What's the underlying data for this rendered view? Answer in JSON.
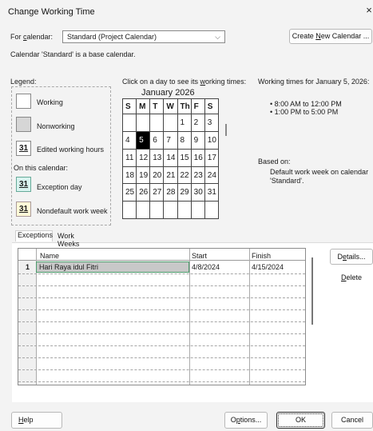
{
  "window": {
    "title": "Change Working Time",
    "close_glyph": "×"
  },
  "calendar_select": {
    "label_prefix": "For ",
    "label_mnemonic": "c",
    "label_suffix": "alendar:",
    "value": "Standard (Project Calendar)",
    "chevron": "⌵"
  },
  "create_button": {
    "prefix": "Create ",
    "mnemonic": "N",
    "suffix": "ew Calendar ..."
  },
  "base_note": "Calendar 'Standard' is a base calendar.",
  "legend": {
    "heading": "Legend:",
    "working": "Working",
    "nonworking": "Nonworking",
    "edited_num": "31",
    "edited": "Edited working hours",
    "on_this_calendar": "On this calendar:",
    "exception_num": "31",
    "exception": "Exception day",
    "nondefault_num": "31",
    "nondefault": "Nondefault work week"
  },
  "calendar_view": {
    "instruction_a": "Click on a day to see its ",
    "instruction_mn": "w",
    "instruction_b": "orking times:",
    "month": "January 2026",
    "days_header": [
      "S",
      "M",
      "T",
      "W",
      "Th",
      "F",
      "S"
    ],
    "weeks": [
      [
        "",
        "",
        "",
        "",
        "1",
        "2",
        "3"
      ],
      [
        "4",
        "5",
        "6",
        "7",
        "8",
        "9",
        "10"
      ],
      [
        "11",
        "12",
        "13",
        "14",
        "15",
        "16",
        "17"
      ],
      [
        "18",
        "19",
        "20",
        "21",
        "22",
        "23",
        "24"
      ],
      [
        "25",
        "26",
        "27",
        "28",
        "29",
        "30",
        "31"
      ],
      [
        "",
        "",
        "",
        "",
        "",
        "",
        ""
      ]
    ],
    "selected_day": "5"
  },
  "working_times": {
    "heading": "Working times for January 5, 2026:",
    "slots": [
      "• 8:00 AM to 12:00 PM",
      "• 1:00 PM to 5:00 PM"
    ],
    "based_on": "Based on:",
    "based_detail_1": "Default work week on calendar",
    "based_detail_2": "'Standard'."
  },
  "tabs": [
    {
      "label": "Exceptions",
      "active": true
    },
    {
      "label": "Work Weeks",
      "active": false
    }
  ],
  "exceptions_table": {
    "columns": [
      "Name",
      "Start",
      "Finish"
    ],
    "rows": [
      {
        "id": "1",
        "name": "Hari Raya idul Fitri",
        "start": "4/8/2024",
        "finish": "4/15/2024"
      }
    ]
  },
  "side_buttons": {
    "details": {
      "prefix": "D",
      "mnemonic": "e",
      "suffix": "tails..."
    },
    "delete": {
      "prefix": "",
      "mnemonic": "D",
      "suffix": "elete"
    }
  },
  "footer": {
    "help": {
      "mnemonic": "H",
      "suffix": "elp"
    },
    "options": {
      "prefix": "O",
      "mnemonic": "p",
      "suffix": "tions..."
    },
    "ok": "OK",
    "cancel": "Cancel"
  }
}
